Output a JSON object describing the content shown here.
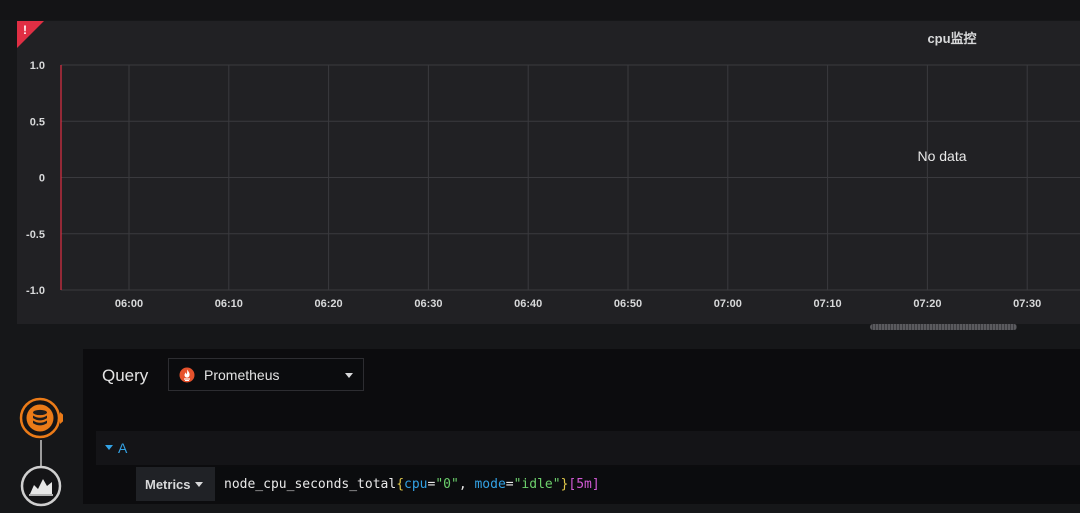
{
  "panel": {
    "title": "cpu监控",
    "no_data": "No data",
    "alert_glyph": "!",
    "alert_color": "#e02f44"
  },
  "chart_data": {
    "type": "line",
    "x_ticks": [
      "06:00",
      "06:10",
      "06:20",
      "06:30",
      "06:40",
      "06:50",
      "07:00",
      "07:10",
      "07:20",
      "07:30"
    ],
    "y_ticks": [
      "1.0",
      "0.5",
      "0",
      "-0.5",
      "-1.0"
    ],
    "ylim": [
      -1.0,
      1.0
    ],
    "series": [],
    "grid": true
  },
  "query_editor": {
    "label": "Query",
    "datasource": "Prometheus",
    "datasource_icon": "prometheus-flame-icon",
    "query_letter": "A",
    "metrics_label": "Metrics",
    "expr": {
      "metric": "node_cpu_seconds_total",
      "open_brace": "{",
      "label1_key": "cpu",
      "eq1": "=",
      "label1_val": "\"0\"",
      "sep": ", ",
      "label2_key": "mode",
      "eq2": "=",
      "label2_val": "\"idle\"",
      "close_brace": "}",
      "range": "[5m]"
    }
  },
  "sidebar": {
    "icons": [
      "database-icon",
      "area-chart-icon"
    ],
    "accent": "#eb7b18"
  }
}
